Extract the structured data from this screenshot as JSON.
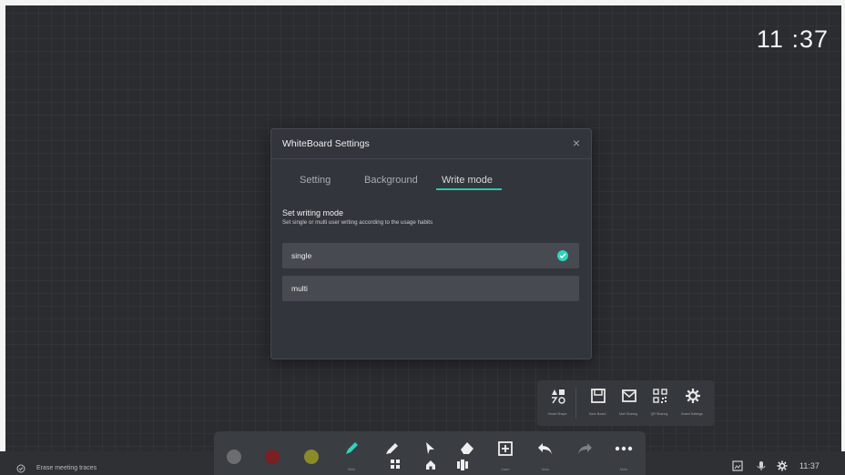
{
  "clock": "11 :37",
  "dialog": {
    "title": "WhiteBoard Settings",
    "close": "×",
    "tabs": [
      {
        "label": "Setting"
      },
      {
        "label": "Background"
      },
      {
        "label": "Write mode"
      }
    ],
    "active_tab": "Write mode",
    "section_title": "Set writing mode",
    "section_desc": "Set single or multi user writing according to the usage habits",
    "options": [
      {
        "label": "single",
        "selected": true
      },
      {
        "label": "multi",
        "selected": false
      }
    ]
  },
  "more_panel": {
    "items": [
      {
        "label": "Smart Shape",
        "icon": "smart-shape-icon"
      },
      {
        "label": "Save Board",
        "icon": "save-icon"
      },
      {
        "label": "Mail Sharing",
        "icon": "mail-icon"
      },
      {
        "label": "QR Sharing",
        "icon": "qr-icon"
      },
      {
        "label": "Board Settings",
        "icon": "gear-icon"
      }
    ]
  },
  "toolbar": {
    "colors": [
      "#6b6d70",
      "#7a1f22",
      "#8a8a2a"
    ],
    "labels": {
      "write": "Write",
      "insert": "Insert",
      "undo": "Undo",
      "more": "More"
    }
  },
  "bottom_bar": {
    "erase_text": "Erase meeting traces",
    "tray_time": "11:37"
  },
  "colors": {
    "accent": "#2fd3bd"
  }
}
